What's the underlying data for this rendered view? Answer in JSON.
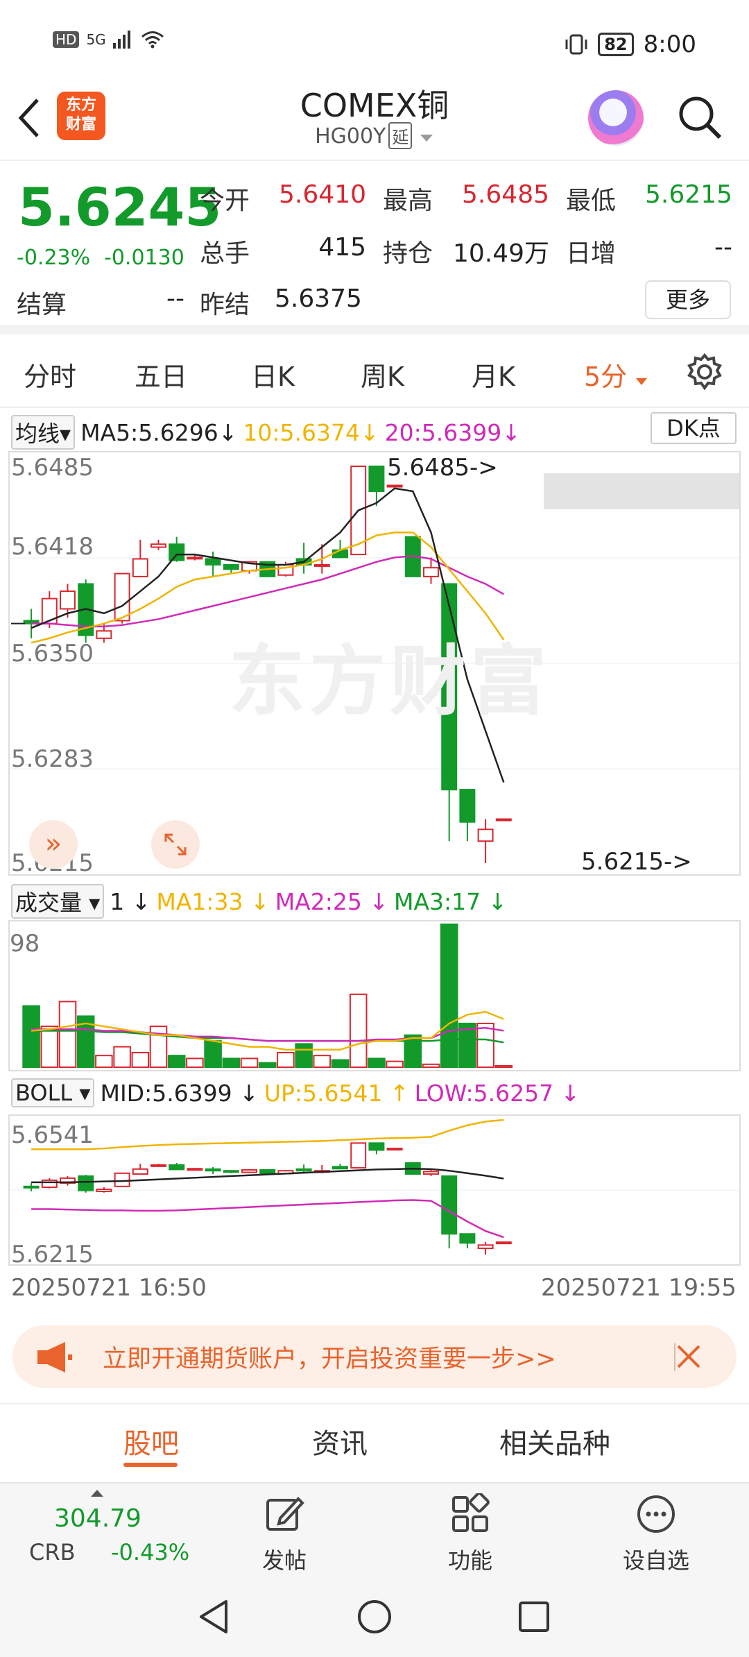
{
  "status": {
    "network": "5G",
    "battery": "82",
    "time": "8:00",
    "hd": "HD"
  },
  "header": {
    "logo_text": "东方财富",
    "title": "COMEX铜",
    "symbol": "HG00Y",
    "symbol_tag": "延"
  },
  "quote": {
    "price": "5.6245",
    "change_pct": "-0.23%",
    "change": "-0.0130",
    "open_label": "今开",
    "open": "5.6410",
    "high_label": "最高",
    "high": "5.6485",
    "low_label": "最低",
    "low": "5.6215",
    "volume_label": "总手",
    "volume": "415",
    "oi_label": "持仓",
    "oi": "10.49万",
    "daily_inc_label": "日增",
    "daily_inc": "--",
    "settle_label": "结算",
    "settle": "--",
    "prev_settle_label": "昨结",
    "prev_settle": "5.6375",
    "more_label": "更多"
  },
  "period_tabs": [
    "分时",
    "五日",
    "日K",
    "周K",
    "月K",
    "5分"
  ],
  "active_period": "5分",
  "ma_legend": {
    "dropdown": "均线",
    "ma5": "MA5:5.6296",
    "ma10": "10:5.6374",
    "ma20": "20:5.6399",
    "dk_label": "DK点",
    "colors": {
      "ma5": "#222222",
      "ma10": "#f0b400",
      "ma20": "#d02ab8"
    }
  },
  "price_axis": [
    "5.6485",
    "5.6418",
    "5.6350",
    "5.6283",
    "5.6215"
  ],
  "high_mark": "5.6485->",
  "low_mark": "5.6215->",
  "watermark": "东方财富",
  "vol_legend": {
    "dropdown": "成交量",
    "current": "1",
    "ma1": "MA1:33",
    "ma2": "MA2:25",
    "ma3": "MA3:17"
  },
  "vol_axis_top": "98",
  "boll_legend": {
    "dropdown": "BOLL",
    "mid": "MID:5.6399",
    "up": "UP:5.6541",
    "low": "LOW:5.6257"
  },
  "boll_axis": [
    "5.6541",
    "5.6215"
  ],
  "time_start": "20250721 16:50",
  "time_end": "20250721 19:55",
  "banner": {
    "text": "立即开通期货账户，开启投资重要一步>>"
  },
  "bottom_tabs": [
    "股吧",
    "资讯",
    "相关品种"
  ],
  "toolbar": {
    "index_value": "304.79",
    "index_name": "CRB",
    "index_change": "-0.43%",
    "post": "发帖",
    "functions": "功能",
    "watchlist": "设自选"
  },
  "chart_data": {
    "type": "candlestick",
    "interval": "5分",
    "ylim": [
      5.6215,
      5.6485
    ],
    "candles": [
      {
        "o": 5.638,
        "h": 5.6388,
        "l": 5.6368,
        "c": 5.6378
      },
      {
        "o": 5.6378,
        "h": 5.64,
        "l": 5.6375,
        "c": 5.6395
      },
      {
        "o": 5.6388,
        "h": 5.6405,
        "l": 5.6382,
        "c": 5.64
      },
      {
        "o": 5.6405,
        "h": 5.6408,
        "l": 5.6365,
        "c": 5.637
      },
      {
        "o": 5.6368,
        "h": 5.6378,
        "l": 5.6365,
        "c": 5.6373
      },
      {
        "o": 5.638,
        "h": 5.6412,
        "l": 5.6378,
        "c": 5.6412
      },
      {
        "o": 5.641,
        "h": 5.6435,
        "l": 5.641,
        "c": 5.6422
      },
      {
        "o": 5.643,
        "h": 5.6435,
        "l": 5.6428,
        "c": 5.6432
      },
      {
        "o": 5.6432,
        "h": 5.6437,
        "l": 5.642,
        "c": 5.6421
      },
      {
        "o": 5.6423,
        "h": 5.6425,
        "l": 5.6421,
        "c": 5.6423
      },
      {
        "o": 5.6422,
        "h": 5.6427,
        "l": 5.641,
        "c": 5.6418
      },
      {
        "o": 5.6418,
        "h": 5.6418,
        "l": 5.6412,
        "c": 5.6415
      },
      {
        "o": 5.6414,
        "h": 5.642,
        "l": 5.6412,
        "c": 5.642
      },
      {
        "o": 5.642,
        "h": 5.642,
        "l": 5.641,
        "c": 5.641
      },
      {
        "o": 5.6411,
        "h": 5.642,
        "l": 5.641,
        "c": 5.6418
      },
      {
        "o": 5.6422,
        "h": 5.6433,
        "l": 5.6412,
        "c": 5.6418
      },
      {
        "o": 5.6418,
        "h": 5.6432,
        "l": 5.6412,
        "c": 5.6418
      },
      {
        "o": 5.6428,
        "h": 5.6435,
        "l": 5.6423,
        "c": 5.6423
      },
      {
        "o": 5.6425,
        "h": 5.6485,
        "l": 5.6425,
        "c": 5.6485
      },
      {
        "o": 5.6485,
        "h": 5.6485,
        "l": 5.6458,
        "c": 5.6468
      },
      {
        "o": 5.6472,
        "h": 5.6472,
        "l": 5.6472,
        "c": 5.6472
      },
      {
        "o": 5.6437,
        "h": 5.6437,
        "l": 5.641,
        "c": 5.641
      },
      {
        "o": 5.641,
        "h": 5.6423,
        "l": 5.6405,
        "c": 5.6416
      },
      {
        "o": 5.6405,
        "h": 5.6405,
        "l": 5.623,
        "c": 5.6265
      },
      {
        "o": 5.6265,
        "h": 5.6265,
        "l": 5.623,
        "c": 5.6243
      },
      {
        "o": 5.623,
        "h": 5.6245,
        "l": 5.6215,
        "c": 5.6238
      },
      {
        "o": 5.6245,
        "h": 5.6245,
        "l": 5.6245,
        "c": 5.6245
      }
    ],
    "ma5": [
      5.6375,
      5.638,
      5.6385,
      5.6388,
      5.6385,
      5.639,
      5.64,
      5.641,
      5.6425,
      5.6425,
      5.6423,
      5.6421,
      5.6419,
      5.6418,
      5.6418,
      5.642,
      5.643,
      5.644,
      5.6455,
      5.646,
      5.647,
      5.6468,
      5.644,
      5.639,
      5.634,
      5.6305,
      5.627
    ],
    "ma10": [
      5.6365,
      5.6368,
      5.6372,
      5.6375,
      5.6378,
      5.6382,
      5.6388,
      5.6395,
      5.6403,
      5.6408,
      5.641,
      5.6412,
      5.6414,
      5.6415,
      5.6416,
      5.6418,
      5.6422,
      5.6428,
      5.6432,
      5.6438,
      5.644,
      5.644,
      5.643,
      5.6415,
      5.64,
      5.6385,
      5.6367
    ],
    "ma20": [
      5.6378,
      5.6378,
      5.6377,
      5.6376,
      5.6376,
      5.6377,
      5.6379,
      5.6381,
      5.6384,
      5.6387,
      5.639,
      5.6393,
      5.6396,
      5.6399,
      5.6402,
      5.6405,
      5.6408,
      5.6412,
      5.6416,
      5.642,
      5.6423,
      5.6424,
      5.6422,
      5.6416,
      5.641,
      5.6405,
      5.6398
    ],
    "volume": {
      "ymax": 98,
      "values": [
        42,
        28,
        45,
        35,
        8,
        14,
        10,
        28,
        8,
        6,
        18,
        6,
        6,
        3,
        10,
        16,
        8,
        5,
        50,
        6,
        4,
        22,
        2,
        98,
        30,
        30,
        1
      ],
      "ma1": [
        25,
        26,
        28,
        30,
        28,
        26,
        24,
        22,
        22,
        20,
        18,
        16,
        14,
        14,
        12,
        12,
        12,
        12,
        16,
        18,
        18,
        20,
        20,
        30,
        36,
        38,
        33
      ],
      "ma2": [
        26,
        26,
        26,
        26,
        25,
        25,
        24,
        23,
        22,
        21,
        21,
        20,
        19,
        18,
        18,
        18,
        18,
        18,
        18,
        19,
        19,
        20,
        20,
        25,
        26,
        27,
        25
      ],
      "ma3": [
        25,
        25,
        25,
        25,
        24,
        24,
        23,
        22,
        21,
        20,
        20,
        20,
        19,
        18,
        18,
        18,
        18,
        18,
        18,
        18,
        18,
        18,
        18,
        19,
        19,
        19,
        17
      ]
    },
    "boll": {
      "ylim": [
        5.6215,
        5.6541
      ],
      "up": [
        5.647,
        5.647,
        5.647,
        5.647,
        5.6472,
        5.6475,
        5.6478,
        5.648,
        5.6482,
        5.6483,
        5.6484,
        5.6485,
        5.6486,
        5.6487,
        5.6488,
        5.6489,
        5.649,
        5.6492,
        5.6494,
        5.6496,
        5.6497,
        5.6498,
        5.65,
        5.6515,
        5.6528,
        5.6537,
        5.6541
      ],
      "mid": [
        5.639,
        5.639,
        5.639,
        5.6391,
        5.6392,
        5.6393,
        5.6395,
        5.6397,
        5.6399,
        5.6401,
        5.6403,
        5.6405,
        5.6407,
        5.6409,
        5.6411,
        5.6413,
        5.6415,
        5.6417,
        5.6419,
        5.6421,
        5.6422,
        5.6423,
        5.6422,
        5.6418,
        5.6412,
        5.6406,
        5.6399
      ],
      "low": [
        5.6325,
        5.6325,
        5.6324,
        5.6323,
        5.6322,
        5.6322,
        5.6321,
        5.6321,
        5.6322,
        5.6324,
        5.6326,
        5.6328,
        5.633,
        5.6332,
        5.6334,
        5.6336,
        5.6338,
        5.634,
        5.6342,
        5.6344,
        5.6346,
        5.6347,
        5.6345,
        5.632,
        5.6295,
        5.6272,
        5.6257
      ]
    }
  }
}
